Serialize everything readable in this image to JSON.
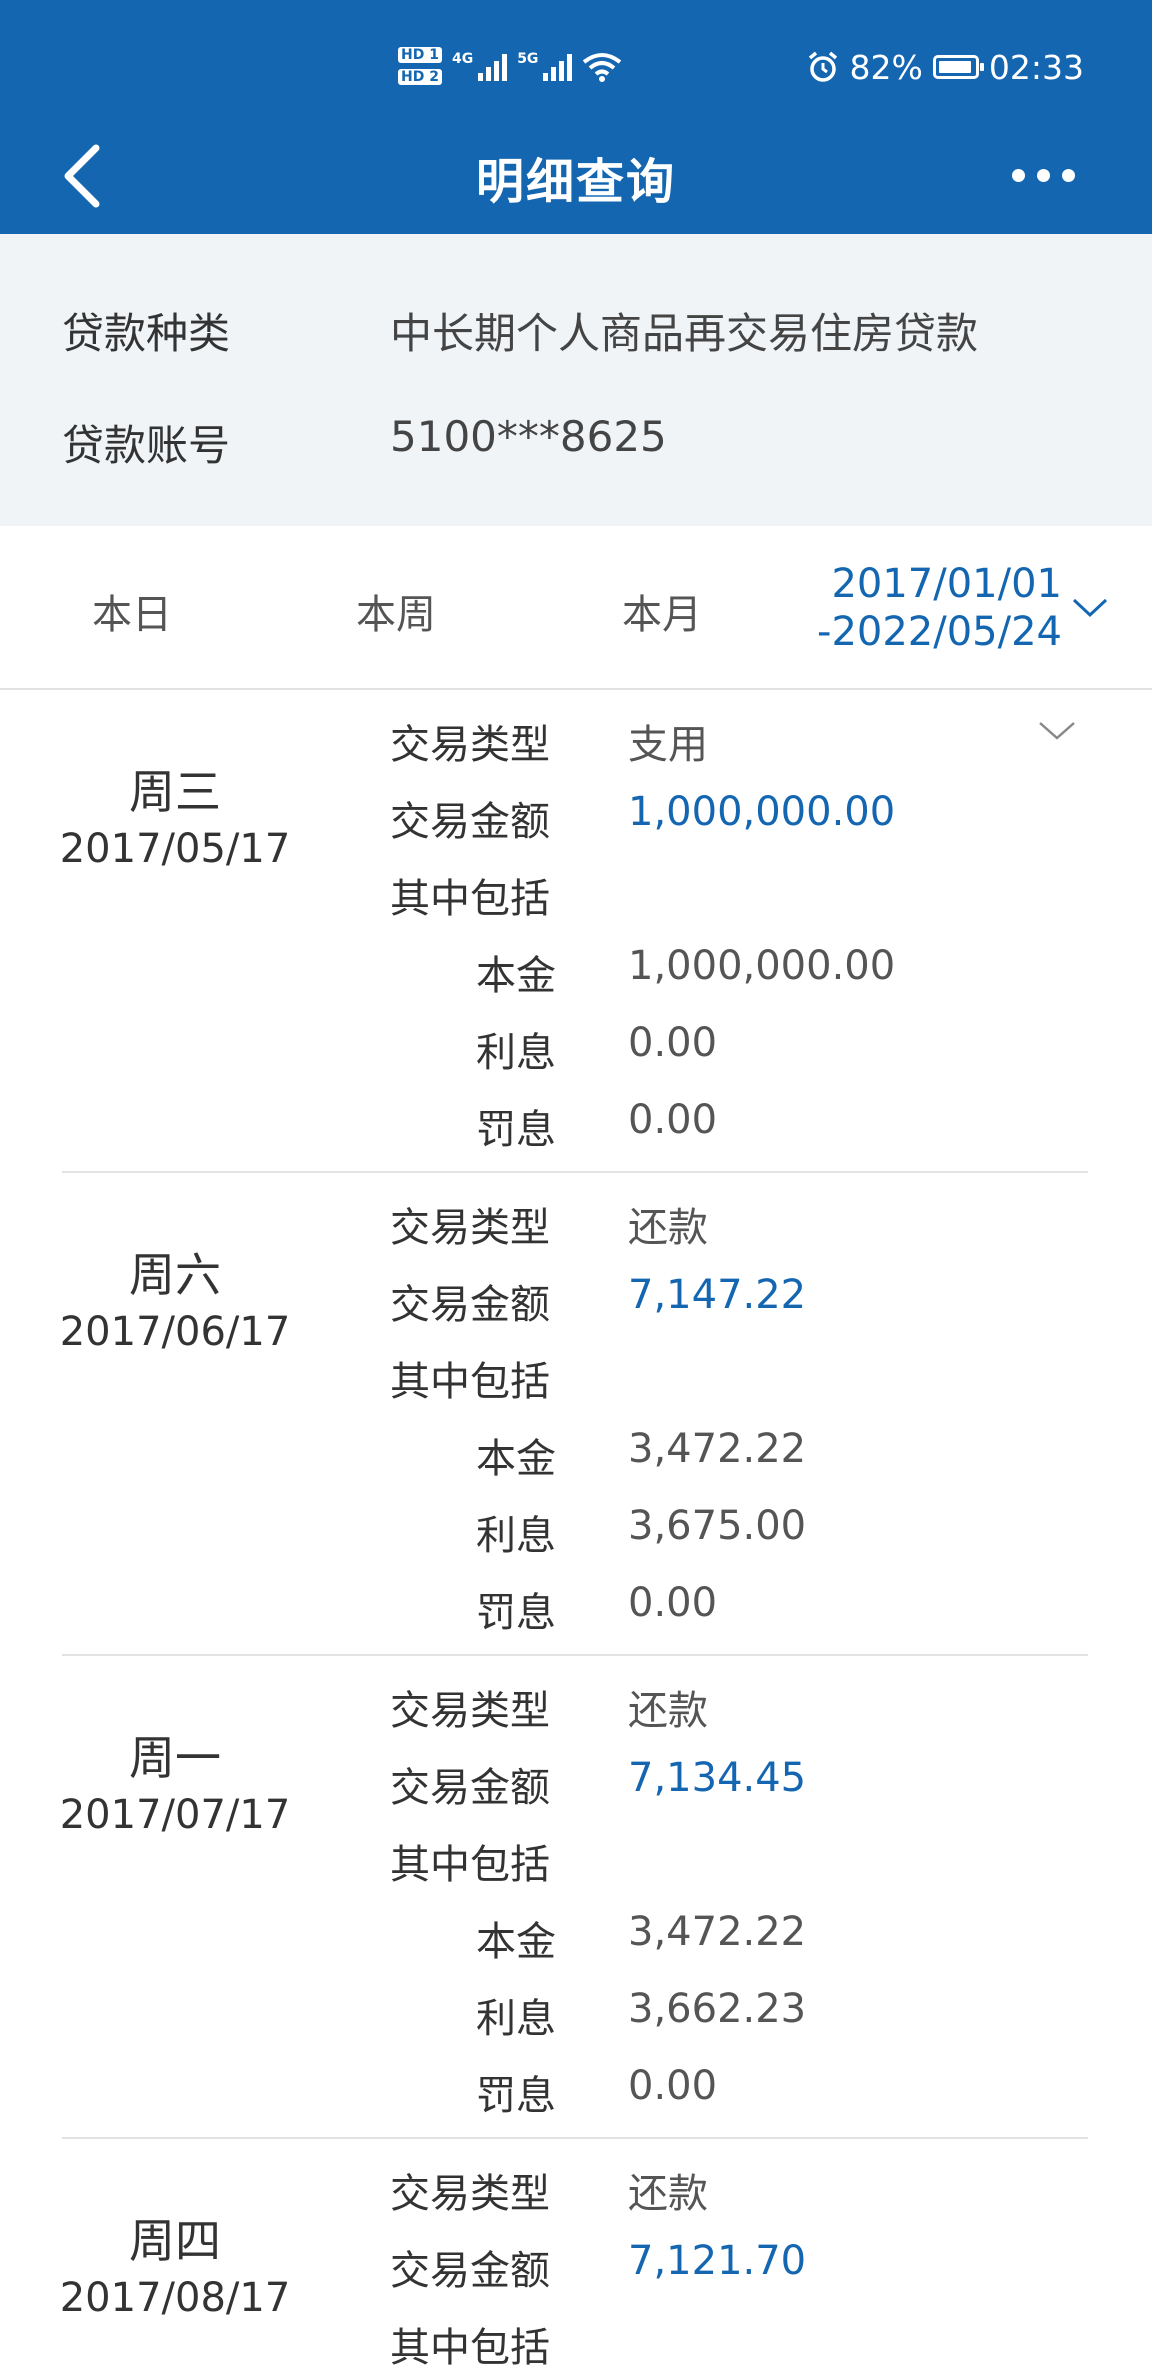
{
  "status_bar": {
    "hd1": "HD 1",
    "hd2": "HD 2",
    "net1": "4G",
    "net2": "5G",
    "battery_percent": "82%",
    "time": "02:33"
  },
  "header": {
    "title": "明细查询"
  },
  "loan_info": {
    "type_label": "贷款种类",
    "type_value": "中长期个人商品再交易住房贷款",
    "account_label": "贷款账号",
    "account_value": "5100***8625"
  },
  "filter": {
    "tabs": [
      "本日",
      "本周",
      "本月"
    ],
    "range_start": "2017/01/01",
    "range_end": "-2022/05/24"
  },
  "labels": {
    "type": "交易类型",
    "amount": "交易金额",
    "includes": "其中包括",
    "principal": "本金",
    "interest": "利息",
    "penalty": "罚息"
  },
  "records": [
    {
      "weekday": "周三",
      "date": "2017/05/17",
      "type": "支用",
      "amount": "1,000,000.00",
      "principal": "1,000,000.00",
      "interest": "0.00",
      "penalty": "0.00"
    },
    {
      "weekday": "周六",
      "date": "2017/06/17",
      "type": "还款",
      "amount": "7,147.22",
      "principal": "3,472.22",
      "interest": "3,675.00",
      "penalty": "0.00"
    },
    {
      "weekday": "周一",
      "date": "2017/07/17",
      "type": "还款",
      "amount": "7,134.45",
      "principal": "3,472.22",
      "interest": "3,662.23",
      "penalty": "0.00"
    },
    {
      "weekday": "周四",
      "date": "2017/08/17",
      "type": "还款",
      "amount": "7,121.70"
    }
  ],
  "colors": {
    "primary": "#1466b1",
    "info_bg": "#f0f4f7",
    "divider": "#e3e3e3"
  },
  "icons": [
    "back-arrow-icon",
    "more-icon",
    "chevron-down-icon",
    "alarm-icon",
    "wifi-icon",
    "battery-icon",
    "signal-icon"
  ]
}
